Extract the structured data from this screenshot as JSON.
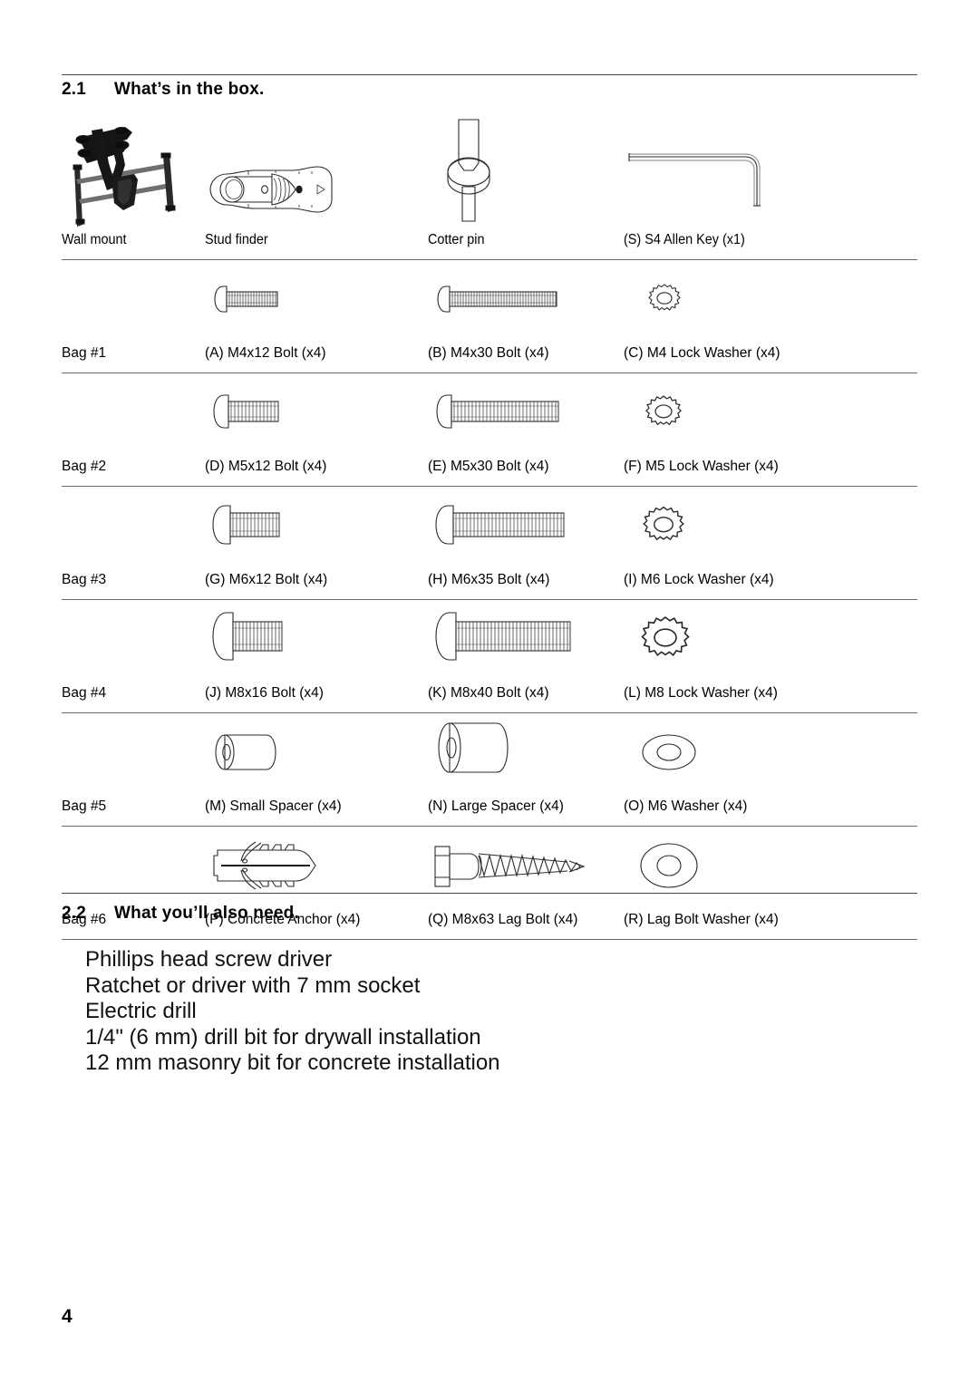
{
  "page": {
    "number": "4"
  },
  "sections": {
    "box": {
      "number": "2.1",
      "title": "What’s in the box."
    },
    "also_need": {
      "number": "2.2",
      "title": "What you’ll also need."
    }
  },
  "parts_table": {
    "rows": [
      {
        "bag": "",
        "items": [
          {
            "label": "Wall mount",
            "icon": "wall-mount-icon"
          },
          {
            "label": "Stud finder",
            "icon": "stud-finder-icon"
          },
          {
            "label": "Cotter pin",
            "icon": "cotter-pin-icon"
          },
          {
            "label": "(S) S4 Allen Key (x1)",
            "icon": "allen-key-icon"
          }
        ]
      },
      {
        "bag": "Bag #1",
        "items": [
          {
            "label": "(A) M4x12 Bolt (x4)",
            "icon": "bolt-icon"
          },
          {
            "label": "(B) M4x30 Bolt (x4)",
            "icon": "bolt-icon"
          },
          {
            "label": "(C) M4 Lock Washer (x4)",
            "icon": "lock-washer-icon"
          }
        ]
      },
      {
        "bag": "Bag #2",
        "items": [
          {
            "label": "(D) M5x12 Bolt (x4)",
            "icon": "bolt-icon"
          },
          {
            "label": "(E) M5x30 Bolt (x4)",
            "icon": "bolt-icon"
          },
          {
            "label": "(F) M5 Lock Washer (x4)",
            "icon": "lock-washer-icon"
          }
        ]
      },
      {
        "bag": "Bag #3",
        "items": [
          {
            "label": "(G) M6x12 Bolt (x4)",
            "icon": "bolt-icon"
          },
          {
            "label": "(H) M6x35 Bolt (x4)",
            "icon": "bolt-icon"
          },
          {
            "label": "(I) M6 Lock Washer (x4)",
            "icon": "lock-washer-icon"
          }
        ]
      },
      {
        "bag": "Bag #4",
        "items": [
          {
            "label": "(J) M8x16 Bolt (x4)",
            "icon": "bolt-icon"
          },
          {
            "label": "(K) M8x40 Bolt (x4)",
            "icon": "bolt-icon"
          },
          {
            "label": "(L) M8 Lock Washer (x4)",
            "icon": "lock-washer-icon"
          }
        ]
      },
      {
        "bag": "Bag #5",
        "items": [
          {
            "label": "(M) Small Spacer (x4)",
            "icon": "spacer-icon"
          },
          {
            "label": "(N) Large Spacer (x4)",
            "icon": "spacer-icon"
          },
          {
            "label": "(O) M6 Washer (x4)",
            "icon": "flat-washer-icon"
          }
        ]
      },
      {
        "bag": "Bag #6",
        "items": [
          {
            "label": "(P) Concrete Anchor (x4)",
            "icon": "concrete-anchor-icon"
          },
          {
            "label": "(Q) M8x63 Lag Bolt (x4)",
            "icon": "lag-bolt-icon"
          },
          {
            "label": "(R) Lag Bolt Washer (x4)",
            "icon": "flat-washer-icon"
          }
        ]
      }
    ]
  },
  "tools_needed": [
    "Phillips head screw driver",
    "Ratchet or driver with 7 mm socket",
    "Electric drill",
    "1/4\" (6 mm) drill bit for drywall installation",
    "12 mm masonry bit for concrete installation"
  ],
  "colors": {
    "text": "#000000",
    "rule": "#6d6d6d",
    "line_art": "#2b2b2b"
  }
}
